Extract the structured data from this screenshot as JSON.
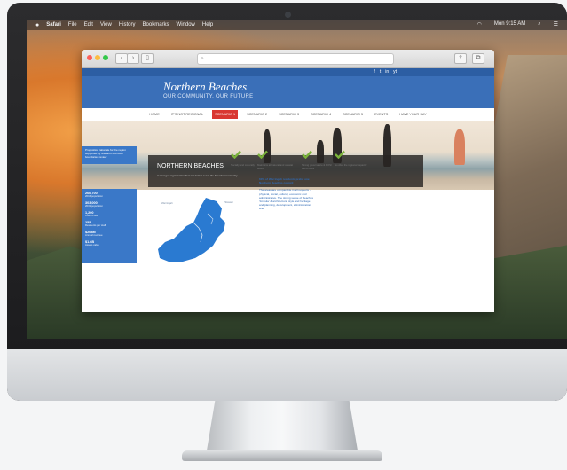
{
  "menubar": {
    "items": [
      "Safari",
      "File",
      "Edit",
      "View",
      "History",
      "Bookmarks",
      "Window",
      "Help"
    ],
    "clock": "Mon 9:15 AM"
  },
  "browser": {
    "toolbar_buttons": [
      "back-icon",
      "forward-icon",
      "sidebar-icon",
      "share-icon",
      "tabs-icon"
    ],
    "url_placeholder": ""
  },
  "site": {
    "social_icons": [
      "f",
      "t",
      "in",
      "yt"
    ],
    "title": "Northern Beaches",
    "tagline": "OUR COMMUNITY, OUR FUTURE",
    "nav": [
      "HOME",
      "IT'S NOT REGIONAL",
      "SCENARIO 1",
      "SCENARIO 2",
      "SCENARIO 3",
      "SCENARIO 4",
      "SCENARIO 5",
      "EVENTS",
      "HAVE YOUR SAY"
    ],
    "nav_active_index": 2,
    "hero": {
      "title": "NORTHERN BEACHES",
      "subtitle": "A stronger organisation that can better serve the broader community"
    },
    "intro_text": "Proposition rationale for the region supported by research into local boundaries review",
    "checks": [
      {
        "label": "Socially and culturally"
      },
      {
        "label": "Maintains all natural and coastal assets"
      },
      {
        "label": "Strong governance & ROSI Benchmark"
      },
      {
        "label": "No Alter the regional capacity"
      }
    ],
    "stats": [
      {
        "value": "266,700",
        "label": "2016 population"
      },
      {
        "value": "303,000",
        "label": "2031 population"
      },
      {
        "value": "1,200",
        "label": "Council staff"
      },
      {
        "value": "255",
        "label": "Residents per staff"
      },
      {
        "value": "$268M",
        "label": "Annual revenue"
      },
      {
        "value": "$1.6B",
        "label": "Assets value"
      }
    ],
    "map_labels": [
      "Warringah",
      "Pittwater"
    ],
    "side_text": [
      "60% of Warringah residents prefer one Northern Beaches council",
      "The areas are comparable in all respects - physical, social, cultural, economic and administrative. The strong sense of Beaches 'formula' & architectural style and heritage and planning, development, administration and"
    ],
    "colors": {
      "brand_blue": "#3a6fb8",
      "nav_active": "#d93732",
      "check_green": "#7bb23a"
    }
  }
}
